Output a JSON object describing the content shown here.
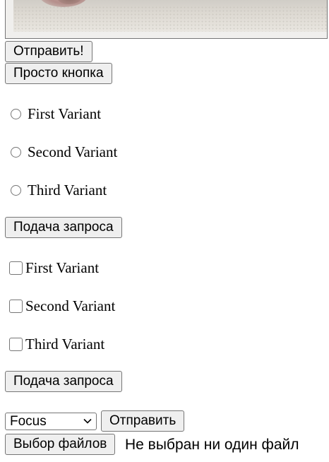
{
  "image_form": {
    "submit_label": "Отправить!"
  },
  "plain_button_label": "Просто кнопка",
  "radio_group": {
    "options": [
      "First Variant",
      "Second Variant",
      "Third Variant"
    ],
    "submit_label": "Подача запроса"
  },
  "checkbox_group": {
    "options": [
      "First Variant",
      "Second Variant",
      "Third Variant"
    ],
    "submit_label": "Подача запроса"
  },
  "select_form": {
    "selected": "Focus",
    "submit_label": "Отправить"
  },
  "file_input": {
    "button_label": "Выбор файлов",
    "status": "Не выбран ни один файл"
  }
}
